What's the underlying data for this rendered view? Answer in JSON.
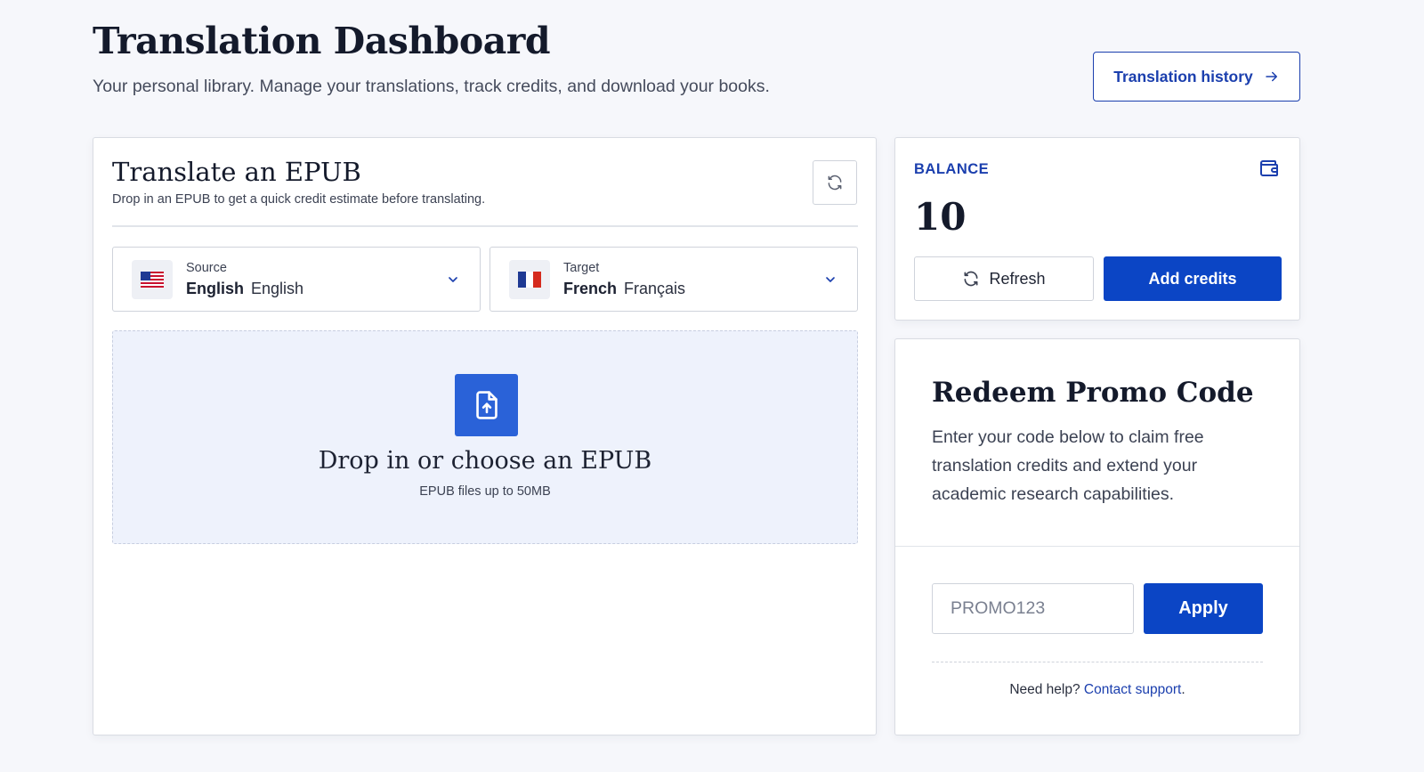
{
  "header": {
    "title": "Translation Dashboard",
    "subtitle": "Your personal library. Manage your translations, track credits, and download your books.",
    "history_button": "Translation history"
  },
  "translate": {
    "title": "Translate an EPUB",
    "subtitle": "Drop in an EPUB to get a quick credit estimate before translating.",
    "source": {
      "label": "Source",
      "language": "English",
      "native": "English",
      "flag_icon": "us-flag-icon"
    },
    "target": {
      "label": "Target",
      "language": "French",
      "native": "Français",
      "flag_icon": "fr-flag-icon"
    },
    "dropzone": {
      "title": "Drop in or choose an EPUB",
      "subtitle": "EPUB files up to 50MB"
    }
  },
  "balance": {
    "label": "BALANCE",
    "value": "10",
    "refresh_label": "Refresh",
    "add_credits_label": "Add credits"
  },
  "promo": {
    "title": "Redeem Promo Code",
    "description": "Enter your code below to claim free translation credits and extend your academic research capabilities.",
    "input_placeholder": "PROMO123",
    "apply_label": "Apply",
    "help_prefix": "Need help?",
    "help_link": "Contact support",
    "help_suffix": "."
  },
  "colors": {
    "primary": "#0b45c5",
    "accent_text": "#1b3fae",
    "dropzone_bg": "#eef2fc",
    "upload_icon_bg": "#2a62d8",
    "page_bg": "#f6f7fb"
  }
}
